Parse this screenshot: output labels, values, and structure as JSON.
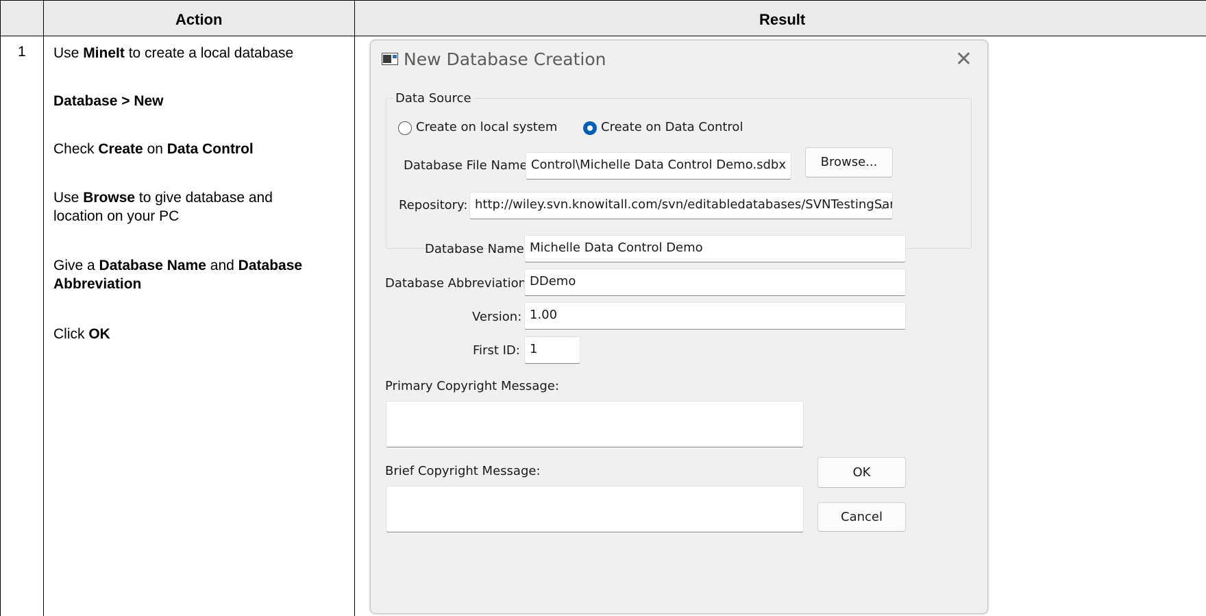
{
  "table": {
    "header_action": "Action",
    "header_result": "Result",
    "row_number": "1"
  },
  "steps": {
    "s1_pre": "Use ",
    "s1_bold": "MineIt",
    "s1_post": " to create a local database",
    "s2_bold": "Database > New",
    "s3_pre": "Check ",
    "s3_bold1": "Create",
    "s3_mid": " on ",
    "s3_bold2": "Data Control",
    "s4_pre": "Use ",
    "s4_bold": "Browse",
    "s4_post": " to give database and",
    "s4_line2": "location on your PC",
    "s5_pre": "Give a ",
    "s5_bold1": "Database Name",
    "s5_mid": " and ",
    "s5_bold2": "Database",
    "s5_bold3": "Abbreviation",
    "s6_pre": "Click ",
    "s6_bold": "OK"
  },
  "dialog": {
    "title": "New Database Creation",
    "close_glyph": "✕",
    "group_label": "Data Source",
    "radio_local_label": "Create on local system",
    "radio_control_label": "Create on Data Control",
    "selected_source": "Create on Data Control",
    "file_name_label": "Database File Name:",
    "file_name_value": "ıta Control\\Michelle Data Control Demo.sdbx",
    "browse_label": "Browse...",
    "repository_label": "Repository:",
    "repository_value": "http://wiley.svn.knowitall.com/svn/editabledatabases/SVNTestingSandl",
    "db_name_label": "Database Name:",
    "db_name_value": "Michelle Data Control Demo",
    "db_abbrev_label": "Database Abbreviation:",
    "db_abbrev_value": "DDemo",
    "version_label": "Version:",
    "version_value": "1.00",
    "first_id_label": "First ID:",
    "first_id_value": "1",
    "primary_copyright_label": "Primary Copyright Message:",
    "primary_copyright_value": "",
    "brief_copyright_label": "Brief Copyright Message:",
    "brief_copyright_value": "",
    "ok_label": "OK",
    "cancel_label": "Cancel"
  },
  "colors": {
    "header_bg": "#eaeaea",
    "dialog_bg": "#f0f0f0",
    "radio_accent": "#005fb8"
  },
  "icons": {
    "window_icon": "window-app-icon",
    "close": "close-icon",
    "dropdown": "chevron-down-icon"
  }
}
